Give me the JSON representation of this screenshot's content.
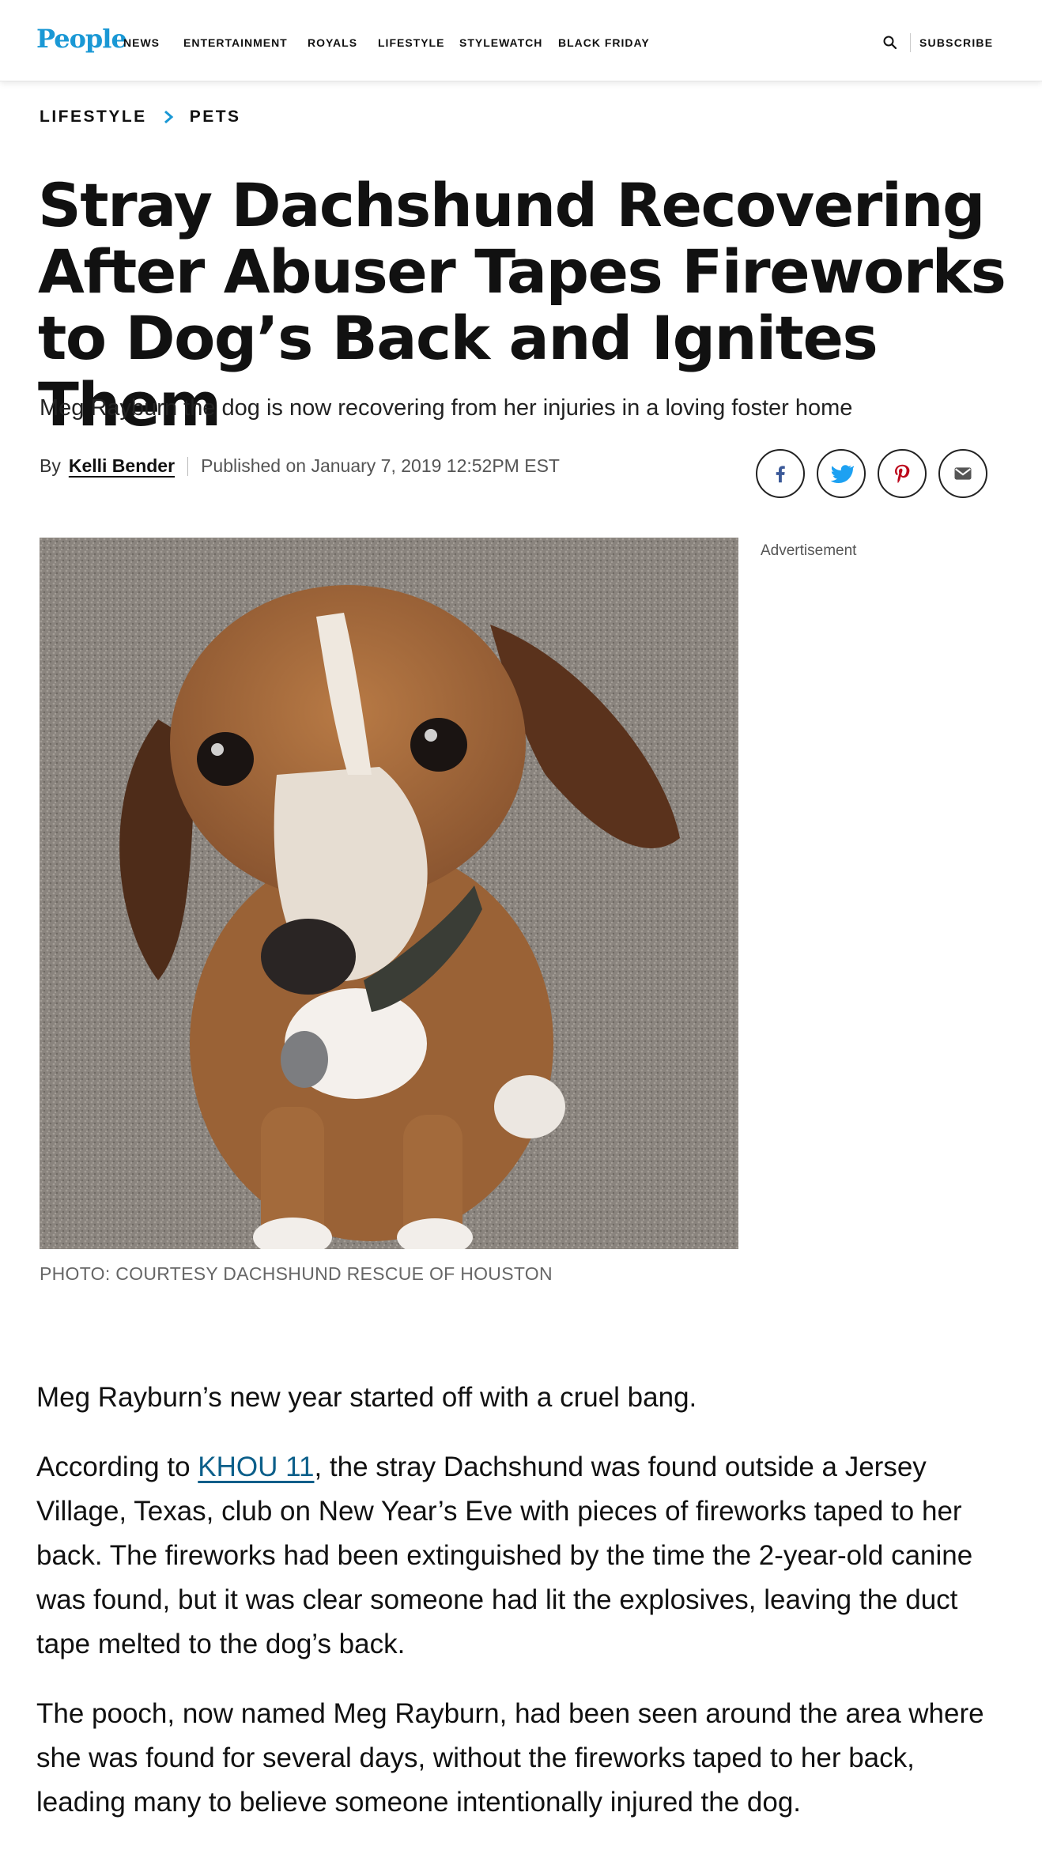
{
  "header": {
    "logo": "People",
    "nav": [
      "NEWS",
      "ENTERTAINMENT",
      "ROYALS",
      "LIFESTYLE",
      "STYLEWATCH",
      "BLACK FRIDAY"
    ],
    "search_icon": "search-icon",
    "subscribe": "SUBSCRIBE"
  },
  "breadcrumb": {
    "items": [
      "LIFESTYLE",
      "PETS"
    ]
  },
  "article": {
    "headline": "Stray Dachshund Recovering After Abuser Tapes Fireworks to Dog’s Back and Ignites Them",
    "subhead": "Meg Rayburn the dog is now recovering from her injuries in a loving foster home",
    "by_label": "By",
    "author": "Kelli Bender",
    "published": "Published on January 7, 2019 12:52PM EST",
    "share": [
      "facebook-icon",
      "twitter-icon",
      "pinterest-icon",
      "email-icon"
    ],
    "photo_caption": "PHOTO: COURTESY DACHSHUND RESCUE OF HOUSTON",
    "advertisement": "Advertisement",
    "paragraphs": {
      "p1": "Meg Rayburn’s new year started off with a cruel bang.",
      "p2_before": "According to ",
      "p2_link": "KHOU 11",
      "p2_after": ", the stray Dachshund was found outside a Jersey Village, Texas, club on New Year’s Eve with pieces of fireworks taped to her back. The fireworks had been extinguished by the time the 2-year-old canine was found, but it was clear someone had lit the explosives, leaving the duct tape melted to the dog’s back.",
      "p3": "The pooch, now named Meg Rayburn, had been seen around the area where she was found for several days, without the fireworks taped to her back, leading many to believe someone intentionally injured the dog."
    }
  },
  "colors": {
    "brand": "#1a98d5",
    "link": "#0c5f8a",
    "facebook": "#3b5998",
    "twitter": "#1da1f2",
    "pinterest": "#bd081c"
  }
}
